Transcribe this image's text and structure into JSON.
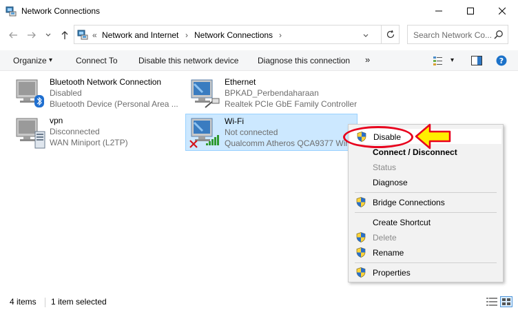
{
  "window": {
    "title": "Network Connections",
    "minimize_glyph": "—",
    "maximize_glyph": "☐",
    "close_glyph": "✕"
  },
  "address_bar": {
    "overflow": "«",
    "crumbs": [
      "Network and Internet",
      "Network Connections"
    ],
    "separator": "›"
  },
  "search": {
    "placeholder": "Search Network Co..."
  },
  "commands": {
    "organize": "Organize",
    "organize_arrow": "▾",
    "connect_to": "Connect To",
    "disable_device": "Disable this network device",
    "diagnose": "Diagnose this connection",
    "more": "»",
    "view_arrow": "▾"
  },
  "connections": [
    {
      "name": "Bluetooth Network Connection",
      "status": "Disabled",
      "device": "Bluetooth Device (Personal Area ..."
    },
    {
      "name": "Ethernet",
      "status": "BPKAD_Perbendaharaan",
      "device": "Realtek PCIe GbE Family Controller"
    },
    {
      "name": "vpn",
      "status": "Disconnected",
      "device": "WAN Miniport (L2TP)"
    },
    {
      "name": "Wi-Fi",
      "status": "Not connected",
      "device": "Qualcomm Atheros QCA9377 Wir"
    }
  ],
  "context_menu": {
    "items": [
      {
        "label": "Disable",
        "shield": true,
        "bold": false,
        "disabled": false
      },
      {
        "label": "Connect / Disconnect",
        "shield": false,
        "bold": true,
        "disabled": false
      },
      {
        "label": "Status",
        "shield": false,
        "bold": false,
        "disabled": true
      },
      {
        "label": "Diagnose",
        "shield": false,
        "bold": false,
        "disabled": false
      },
      {
        "label": "Bridge Connections",
        "shield": true,
        "bold": false,
        "disabled": false
      },
      {
        "label": "Create Shortcut",
        "shield": false,
        "bold": false,
        "disabled": false
      },
      {
        "label": "Delete",
        "shield": true,
        "bold": false,
        "disabled": true
      },
      {
        "label": "Rename",
        "shield": true,
        "bold": false,
        "disabled": false
      },
      {
        "label": "Properties",
        "shield": true,
        "bold": false,
        "disabled": false
      }
    ]
  },
  "status_bar": {
    "count": "4 items",
    "selection": "1 item selected"
  },
  "colors": {
    "annotation_red": "#e8001c",
    "annotation_yellow": "#ffef00",
    "selection_bg": "#cce8ff",
    "selection_border": "#99d1ff"
  }
}
